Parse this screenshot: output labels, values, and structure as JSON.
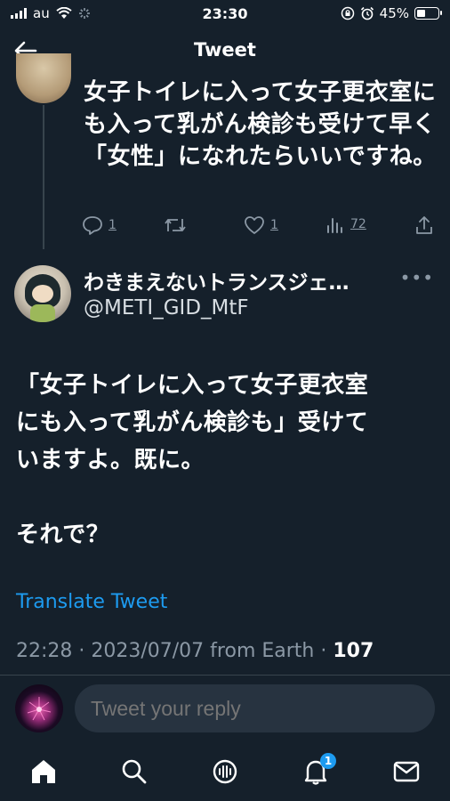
{
  "status_bar": {
    "carrier": "au",
    "time": "23:30",
    "battery": "45%",
    "battery_level": 0.45
  },
  "header": {
    "title": "Tweet"
  },
  "parent_tweet": {
    "text": "女子トイレに入って女子更衣室にも入って乳がん検診も受けて早く「女性」になれたらいいですね。",
    "replies": "1",
    "likes": "1",
    "views": "72"
  },
  "tweet": {
    "display_name": "わきまえないトランスジェ…",
    "handle": "@METI_GID_MtF",
    "text": "「女子トイレに入って女子更衣室\nにも入って乳がん検診も」受けて\nいますよ。既に。\n\nそれで？",
    "translate_label": "Translate Tweet",
    "timestamp": "22:28 · 2023/07/07 from Earth · ",
    "view_count": "107"
  },
  "reply": {
    "placeholder": "Tweet your reply"
  },
  "tabbar": {
    "notifications_badge": "1"
  },
  "colors": {
    "background": "#15202b",
    "accent": "#1d9bf0",
    "muted": "#8b98a5"
  }
}
